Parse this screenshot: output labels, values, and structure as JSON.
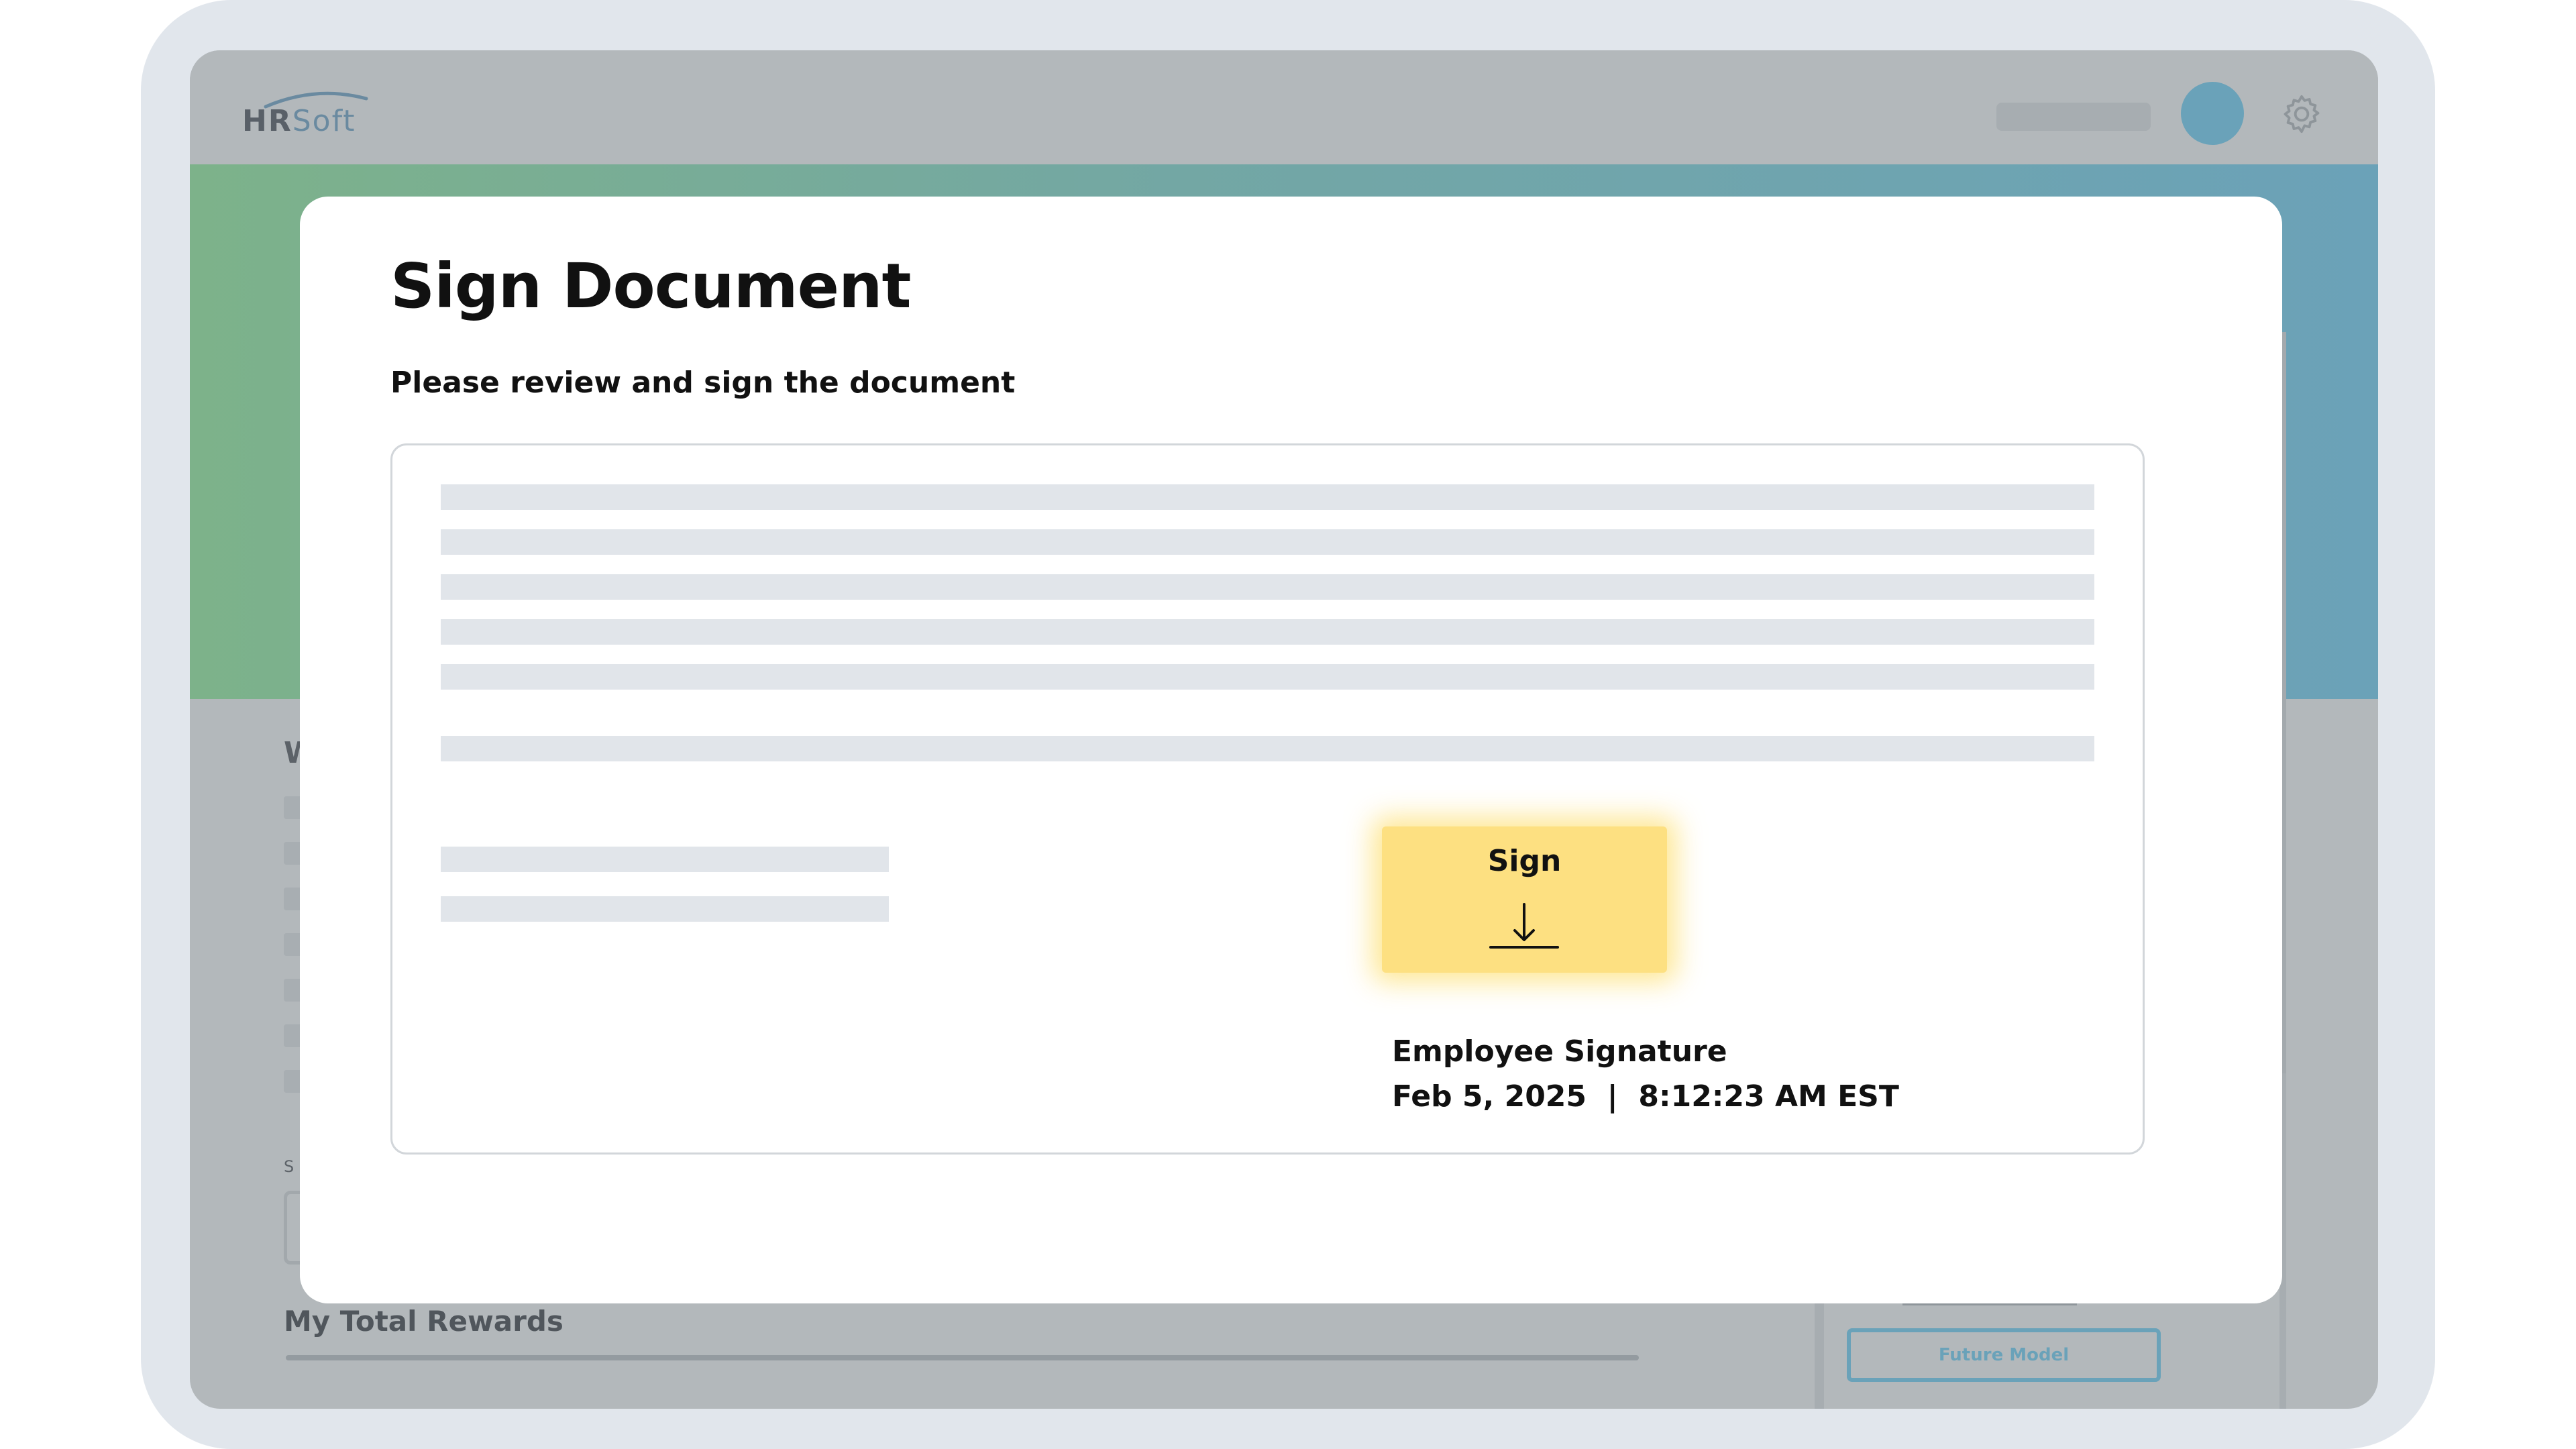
{
  "app": {
    "logo_hr": "HR",
    "logo_soft": "Soft"
  },
  "background": {
    "section_letter": "W",
    "small_label": "S",
    "rewards_title": "My Total Rewards",
    "future_button": "Future Model",
    "avatar_color": "#6aa2b9",
    "banner_gradient": [
      "#7db28a",
      "#6ba2b8"
    ]
  },
  "modal": {
    "title": "Sign Document",
    "subtitle": "Please review and sign the document",
    "sign_button": {
      "label": "Sign",
      "icon": "download-arrow-icon",
      "color": "#fde081"
    },
    "signature_label": "Employee Signature",
    "signature_date": "Feb 5, 2025  |  8:12:23 AM EST"
  },
  "icons": {
    "settings": "gear-icon",
    "sign": "download-arrow-icon"
  }
}
